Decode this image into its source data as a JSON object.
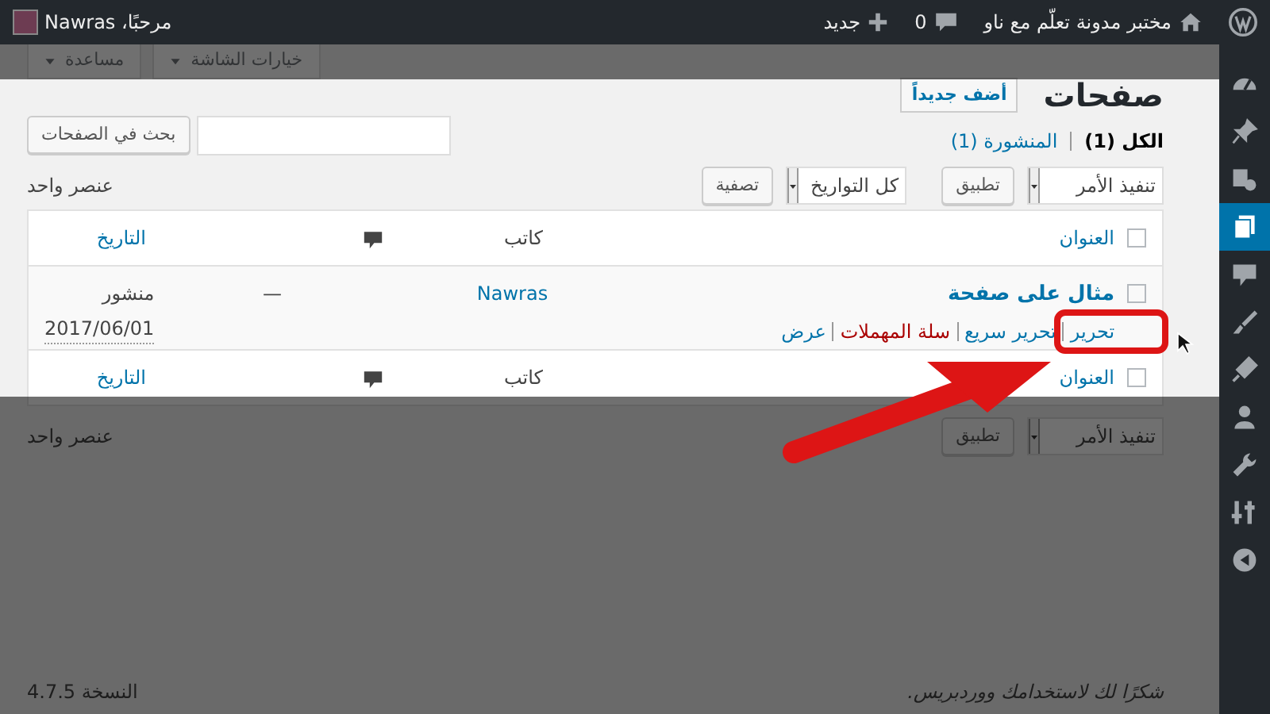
{
  "admin_bar": {
    "site_name": "مختبر مدونة تعلّم مع ناو",
    "comments_count": "0",
    "new_label": "جديد",
    "greeting": "مرحبًا، Nawras"
  },
  "screen_meta": [
    {
      "label": "خيارات الشاشة"
    },
    {
      "label": "مساعدة"
    }
  ],
  "page": {
    "title": "صفحات",
    "add_new": "أضف جديداً"
  },
  "views": [
    {
      "label": "الكل",
      "count": "(1)",
      "selected": true
    },
    {
      "label": "المنشورة",
      "count": "(1)",
      "selected": false
    }
  ],
  "search": {
    "button": "بحث في الصفحات"
  },
  "tablenav_top": {
    "bulk_action": "تنفيذ الأمر",
    "apply": "تطبيق",
    "date_filter": "كل التواريخ",
    "filter": "تصفية",
    "items_count": "عنصر واحد"
  },
  "table": {
    "header": {
      "checked": false,
      "title": "العنوان",
      "author": "كاتب",
      "date": "التاريخ"
    },
    "rows": [
      {
        "checked": false,
        "title": "مثال على صفحة",
        "actions": [
          {
            "label": "تحرير",
            "kind": "link"
          },
          {
            "label": "تحرير سريع",
            "kind": "link"
          },
          {
            "label": "سلة المهملات",
            "kind": "trash"
          },
          {
            "label": "عرض",
            "kind": "link"
          }
        ],
        "author": "Nawras",
        "comments": "—",
        "status": "منشور",
        "date": "2017/06/01"
      }
    ],
    "footer": {
      "checked": false,
      "title": "العنوان",
      "author": "كاتب",
      "date": "التاريخ"
    }
  },
  "tablenav_bottom": {
    "bulk_action": "تنفيذ الأمر",
    "apply": "تطبيق",
    "items_count": "عنصر واحد"
  },
  "footer": {
    "thanks": "شكرًا لك لاستخدامك ووردبريس.",
    "version": "النسخة 4.7.5"
  },
  "sidebar": {
    "items": [
      {
        "kind": "dashboard",
        "selected": false
      },
      {
        "kind": "posts",
        "selected": false
      },
      {
        "kind": "media",
        "selected": false
      },
      {
        "kind": "pages",
        "selected": true
      },
      {
        "kind": "comments",
        "selected": false
      },
      {
        "kind": "appearance",
        "selected": false
      },
      {
        "kind": "plugins",
        "selected": false
      },
      {
        "kind": "users",
        "selected": false
      },
      {
        "kind": "tools",
        "selected": false
      },
      {
        "kind": "settings",
        "selected": false
      },
      {
        "kind": "collapse",
        "selected": false
      }
    ]
  }
}
